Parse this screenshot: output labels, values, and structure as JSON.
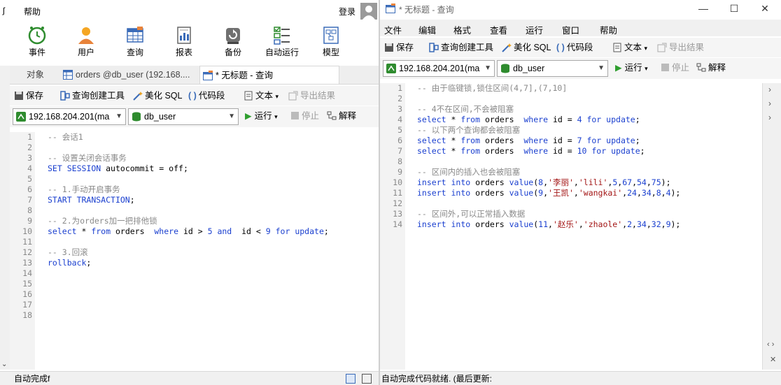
{
  "left": {
    "menu": {
      "help": "帮助",
      "login": "登录"
    },
    "main_toolbar": [
      {
        "label": "事件",
        "icon": "clock-icon"
      },
      {
        "label": "用户",
        "icon": "user-icon"
      },
      {
        "label": "查询",
        "icon": "table-icon"
      },
      {
        "label": "报表",
        "icon": "report-icon"
      },
      {
        "label": "备份",
        "icon": "backup-icon"
      },
      {
        "label": "自动运行",
        "icon": "checklist-icon"
      },
      {
        "label": "模型",
        "icon": "model-icon"
      }
    ],
    "tabs": [
      {
        "label": "对象"
      },
      {
        "label": "orders @db_user (192.168...."
      },
      {
        "label": "* 无标题 - 查询"
      }
    ],
    "query_toolbar": {
      "save": "保存",
      "builder": "查询创建工具",
      "beautify": "美化 SQL",
      "snippet": "代码段",
      "text": "文本",
      "export": "导出结果"
    },
    "connection": "192.168.204.201(ma",
    "database": "db_user",
    "run": "运行",
    "stop": "停止",
    "explain": "解释",
    "line_numbers": [
      "1",
      "2",
      "3",
      "4",
      "5",
      "6",
      "7",
      "8",
      "9",
      "10",
      "11",
      "12",
      "13",
      "14",
      "15",
      "16",
      "17",
      "18"
    ],
    "status": "自动完成f"
  },
  "right": {
    "title": "* 无标题 - 查询",
    "menu": [
      "文件",
      "编辑",
      "格式",
      "查看",
      "运行",
      "窗口",
      "帮助"
    ],
    "query_toolbar": {
      "save": "保存",
      "builder": "查询创建工具",
      "beautify": "美化 SQL",
      "snippet": "代码段",
      "text": "文本",
      "export": "导出结果"
    },
    "connection": "192.168.204.201(ma",
    "database": "db_user",
    "run": "运行",
    "stop": "停止",
    "explain": "解释",
    "line_numbers": [
      "1",
      "2",
      "3",
      "4",
      "5",
      "6",
      "7",
      "8",
      "9",
      "10",
      "11",
      "12",
      "13",
      "14"
    ],
    "status": "自动完成代码就绪. (最后更新:"
  },
  "colors": {
    "keyword": "#1a3fcf",
    "comment": "#8a8a8a",
    "string": "#a31515",
    "run_green": "#2e9e2e"
  },
  "left_code": [
    "-- 会话1",
    "",
    "-- 设置关闭会话事务",
    "SET SESSION autocommit = off;",
    "",
    "-- 1.手动开启事务",
    "START TRANSACTION;",
    "",
    "-- 2.为orders加一把排他锁",
    "select * from orders  where id > 5 and  id < 9 for update;",
    "",
    "-- 3.回滚",
    "rollback;"
  ],
  "right_code": [
    "-- 由于临键锁,锁住区间(4,7],(7,10]",
    "",
    "-- 4不在区间,不会被阻塞",
    "select * from orders  where id = 4 for update;",
    "-- 以下两个查询都会被阻塞",
    "select * from orders  where id = 7 for update;",
    "select * from orders  where id = 10 for update;",
    "",
    "-- 区间内的插入也会被阻塞",
    "insert into orders value(8,'李丽','lili',5,67,54,75);",
    "insert into orders value(9,'王凯','wangkai',24,34,8,4);",
    "",
    "-- 区间外,可以正常插入数据",
    "insert into orders value(11,'赵乐','zhaole',2,34,32,9);"
  ]
}
